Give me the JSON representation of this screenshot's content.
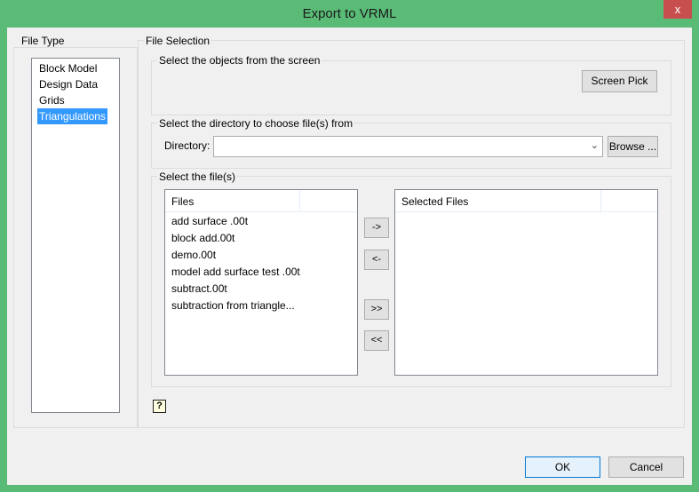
{
  "window": {
    "title": "Export to VRML",
    "close_label": "x"
  },
  "file_type": {
    "label": "File Type",
    "items": [
      "Block Model",
      "Design Data",
      "Grids",
      "Triangulations"
    ],
    "selected": "Triangulations"
  },
  "file_selection": {
    "label": "File Selection",
    "screen_group": {
      "label": "Select the objects from the screen",
      "button": "Screen Pick"
    },
    "dir_group": {
      "label": "Select the directory to choose file(s) from",
      "dir_label": "Directory:",
      "dir_value": "",
      "browse": "Browse ..."
    },
    "files_group": {
      "label": "Select the file(s)",
      "files_header": "Files",
      "selected_header": "Selected Files",
      "files": [
        "add surface .00t",
        "block add.00t",
        "demo.00t",
        "model add surface test .00t",
        "subtract.00t",
        "subtraction from triangle..."
      ],
      "add": "->",
      "remove": "<-",
      "add_all": ">>",
      "remove_all": "<<"
    }
  },
  "help_icon": "?",
  "footer": {
    "ok": "OK",
    "cancel": "Cancel"
  },
  "colors": {
    "titlebar": "#5abb77",
    "close": "#c7504f",
    "selection": "#3399ff"
  }
}
